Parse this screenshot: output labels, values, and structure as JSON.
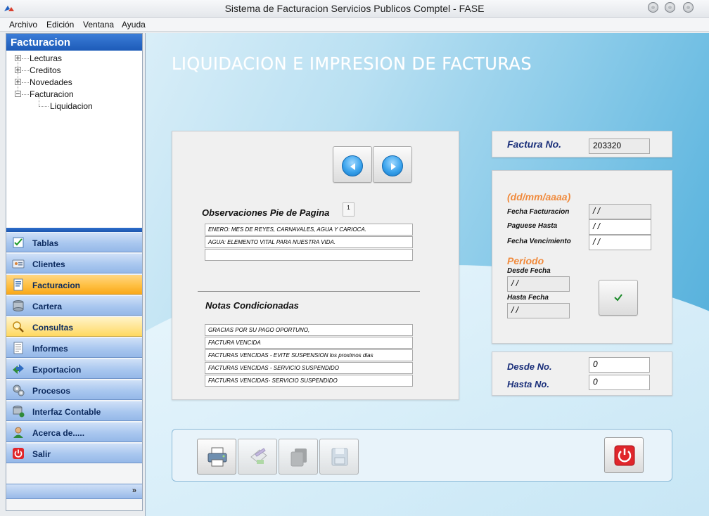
{
  "window": {
    "title": "Sistema de Facturacion Servicios Publicos Comptel - FASE"
  },
  "menu": [
    "Archivo",
    "Edición",
    "Ventana",
    "Ayuda"
  ],
  "tree": {
    "header": "Facturacion",
    "items": [
      "Lecturas",
      "Creditos",
      "Novedades",
      "Facturacion"
    ],
    "child": "Liquidacion"
  },
  "nav": [
    {
      "label": "Tablas",
      "icon": "checklist-icon",
      "state": "normal"
    },
    {
      "label": "Clientes",
      "icon": "id-card-icon",
      "state": "normal"
    },
    {
      "label": "Facturacion",
      "icon": "invoice-icon",
      "state": "selected"
    },
    {
      "label": "Cartera",
      "icon": "database-icon",
      "state": "normal"
    },
    {
      "label": "Consultas",
      "icon": "magnifier-icon",
      "state": "hover"
    },
    {
      "label": "Informes",
      "icon": "report-icon",
      "state": "normal"
    },
    {
      "label": "Exportacion",
      "icon": "export-arrows-icon",
      "state": "normal"
    },
    {
      "label": "Procesos",
      "icon": "gears-icon",
      "state": "normal"
    },
    {
      "label": "Interfaz Contable",
      "icon": "database-link-icon",
      "state": "normal"
    },
    {
      "label": "Acerca de.....",
      "icon": "user-icon",
      "state": "normal"
    },
    {
      "label": "Salir",
      "icon": "power-icon",
      "state": "normal"
    }
  ],
  "main": {
    "title": "LIQUIDACION E IMPRESION DE FACTURAS",
    "observaciones": {
      "title": "Observaciones Pie de Pagina",
      "page_indicator": "1",
      "lines": [
        "ENERO: MES DE REYES, CARNAVALES, AGUA Y CARIOCA.",
        "AGUA: ELEMENTO VITAL PARA NUESTRA VIDA.",
        ""
      ]
    },
    "notas": {
      "title": "Notas Condicionadas",
      "lines": [
        "GRACIAS POR SU PAGO OPORTUNO,",
        "FACTURA VENCIDA",
        "FACTURAS VENCIDAS - EVITE SUSPENSION  los proximos dias",
        "FACTURAS VENCIDAS - SERVICIO SUSPENDIDO",
        "FACTURAS VENCIDAS- SERVICIO SUSPENDIDO"
      ]
    },
    "factura": {
      "label": "Factura No.",
      "value": "203320"
    },
    "fechas": {
      "format_hint": "(dd/mm/aaaa)",
      "facturacion_label": "Fecha Facturacion",
      "facturacion_value": " / /",
      "paguese_label": "Paguese Hasta",
      "paguese_value": " / /",
      "vencimiento_label": "Fecha Vencimiento",
      "vencimiento_value": " / /",
      "periodo_label": "Periodo",
      "desde_label": "Desde Fecha",
      "desde_value": " / /",
      "hasta_label": "Hasta Fecha",
      "hasta_value": " / /"
    },
    "rango": {
      "desde_label": "Desde No.",
      "desde_value": "0",
      "hasta_label": "Hasta No.",
      "hasta_value": "0"
    }
  },
  "colors": {
    "accent_orange": "#f08a3c",
    "label_navy": "#1a2f7a",
    "exit_red": "#e0262b"
  }
}
